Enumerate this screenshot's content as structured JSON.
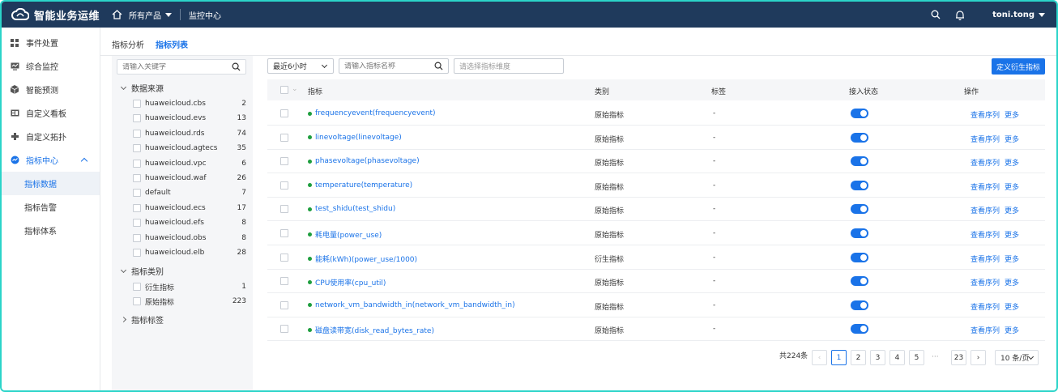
{
  "header": {
    "app_title": "智能业务运维",
    "products_label": "所有产品",
    "monitor_center": "监控中心",
    "user_name": "toni.tong"
  },
  "sidebar": {
    "items": [
      {
        "label": "事件处置",
        "icon": "grid-icon"
      },
      {
        "label": "综合监控",
        "icon": "monitor-icon"
      },
      {
        "label": "智能预测",
        "icon": "cube-icon"
      },
      {
        "label": "自定义看板",
        "icon": "dashboard-icon"
      },
      {
        "label": "自定义拓扑",
        "icon": "topology-icon"
      },
      {
        "label": "指标中心",
        "icon": "metric-icon"
      }
    ],
    "sub_items": [
      {
        "label": "指标数据"
      },
      {
        "label": "指标告警"
      },
      {
        "label": "指标体系"
      }
    ]
  },
  "tabs": [
    {
      "label": "指标分析"
    },
    {
      "label": "指标列表"
    }
  ],
  "filter": {
    "search_placeholder": "请输入关键字",
    "source_group": "数据来源",
    "sources": [
      {
        "name": "huaweicloud.cbs",
        "count": "2"
      },
      {
        "name": "huaweicloud.evs",
        "count": "13"
      },
      {
        "name": "huaweicloud.rds",
        "count": "74"
      },
      {
        "name": "huaweicloud.agtecs",
        "count": "35"
      },
      {
        "name": "huaweicloud.vpc",
        "count": "6"
      },
      {
        "name": "huaweicloud.waf",
        "count": "26"
      },
      {
        "name": "default",
        "count": "7"
      },
      {
        "name": "huaweicloud.ecs",
        "count": "17"
      },
      {
        "name": "huaweicloud.efs",
        "count": "8"
      },
      {
        "name": "huaweicloud.obs",
        "count": "8"
      },
      {
        "name": "huaweicloud.elb",
        "count": "28"
      }
    ],
    "category_group": "指标类别",
    "categories": [
      {
        "name": "衍生指标",
        "count": "1"
      },
      {
        "name": "原始指标",
        "count": "223"
      }
    ],
    "tag_group": "指标标签"
  },
  "toolbar": {
    "time_range": "最近6小时",
    "metric_search_placeholder": "请输入指标名称",
    "dimension_placeholder": "请选择指标维度",
    "define_button": "定义衍生指标"
  },
  "table": {
    "headers": {
      "metric": "指标",
      "type": "类别",
      "tag": "标签",
      "status": "接入状态",
      "ops": "操作"
    },
    "rows": [
      {
        "metric": "frequencyevent(frequencyevent)",
        "type": "原始指标",
        "tag": "-"
      },
      {
        "metric": "linevoltage(linevoltage)",
        "type": "原始指标",
        "tag": "-"
      },
      {
        "metric": "phasevoltage(phasevoltage)",
        "type": "原始指标",
        "tag": "-"
      },
      {
        "metric": "temperature(temperature)",
        "type": "原始指标",
        "tag": "-"
      },
      {
        "metric": "test_shidu(test_shidu)",
        "type": "原始指标",
        "tag": "-"
      },
      {
        "metric": "耗电量(power_use)",
        "type": "原始指标",
        "tag": "-"
      },
      {
        "metric": "能耗(kWh)(power_use/1000)",
        "type": "衍生指标",
        "tag": "-"
      },
      {
        "metric": "CPU使用率(cpu_util)",
        "type": "原始指标",
        "tag": "-"
      },
      {
        "metric": "network_vm_bandwidth_in(network_vm_bandwidth_in)",
        "type": "原始指标",
        "tag": "-"
      },
      {
        "metric": "磁盘读带宽(disk_read_bytes_rate)",
        "type": "原始指标",
        "tag": "-"
      }
    ],
    "op_view": "查看序列",
    "op_more": "更多"
  },
  "pagination": {
    "total": "共224条",
    "pages": [
      "1",
      "2",
      "3",
      "4",
      "5"
    ],
    "ellipsis": "···",
    "last_page": "23",
    "page_size": "10 条/页",
    "current": "1"
  }
}
